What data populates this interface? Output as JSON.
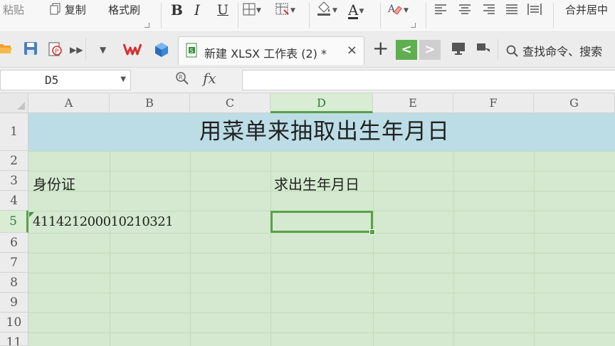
{
  "ribbon": {
    "paste_label": "粘贴",
    "copy_label": "复制",
    "format_painter_label": "格式刷",
    "bold_label": "B",
    "italic_label": "I",
    "underline_label": "U",
    "font_color_label": "A",
    "merge_center_label": "合并居中"
  },
  "tabs": {
    "document_tab": "新建 XLSX 工作表 (2) *",
    "close_glyph": "×",
    "add_glyph": "+",
    "prev_glyph": "<",
    "next_glyph": ">",
    "find_command": "查找命令、搜索"
  },
  "formula_bar": {
    "name_box_value": "D5",
    "fx_label": "fx",
    "formula_value": ""
  },
  "sheet": {
    "columns": [
      "A",
      "B",
      "C",
      "D",
      "E",
      "F",
      "G"
    ],
    "rows": [
      "1",
      "2",
      "3",
      "4",
      "5",
      "6",
      "7",
      "8",
      "9",
      "10",
      "11"
    ],
    "active_column": "D",
    "active_row": "5",
    "cells": {
      "title": "用菜单来抽取出生年月日",
      "a3": "身份证",
      "d3": "求出生年月日",
      "a5": "411421200010210321"
    }
  },
  "colors": {
    "accent_green": "#5aa04a",
    "grid_green": "#d4e9cf",
    "title_band": "#bcdde6",
    "wps_red": "#d6302f"
  }
}
